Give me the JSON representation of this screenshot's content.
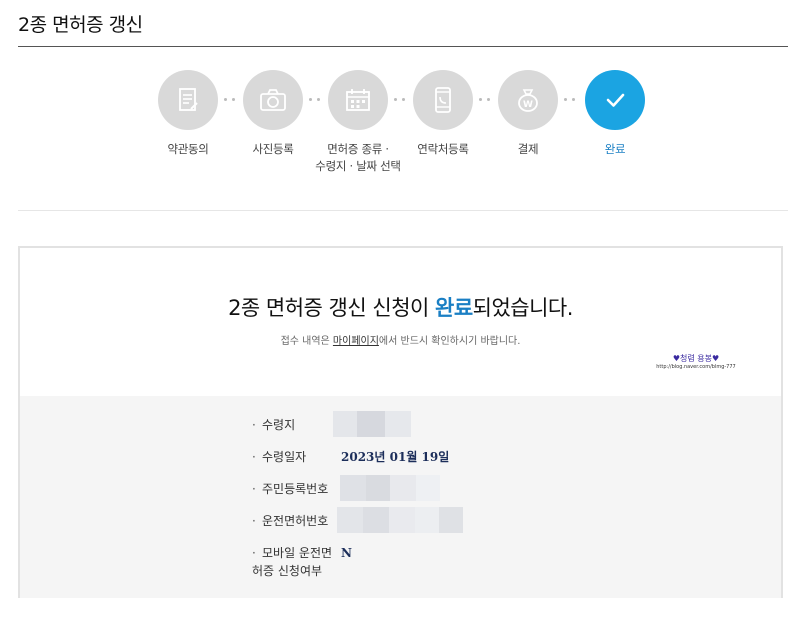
{
  "page": {
    "title": "2종 면허증 갱신"
  },
  "steps": [
    {
      "label": "약관동의",
      "icon": "document-icon",
      "state": "done"
    },
    {
      "label": "사진등록",
      "icon": "camera-icon",
      "state": "done"
    },
    {
      "label": "면허증 종류 ·\n수령지 · 날짜 선택",
      "icon": "calendar-icon",
      "state": "done"
    },
    {
      "label": "연락처등록",
      "icon": "phone-icon",
      "state": "done"
    },
    {
      "label": "결제",
      "icon": "money-bag-icon",
      "state": "done"
    },
    {
      "label": "완료",
      "icon": "check-icon",
      "state": "active"
    }
  ],
  "colors": {
    "active": "#1ba4e2",
    "inactive": "#d9d9d9",
    "highlight": "#1a7fc4"
  },
  "result": {
    "heading_pre": "2종 면허증 갱신 신청이 ",
    "heading_highlight": "완료",
    "heading_post": "되었습니다.",
    "sub_pre": "접수 내역은 ",
    "sub_link": "마이페이지",
    "sub_post": "에서 반드시 확인하시기 바랍니다.",
    "watermark_line1": "♥청렴 용봉♥",
    "watermark_line2": "http://blog.naver.com/blmg-777"
  },
  "info": {
    "bullet": "·",
    "pickup_location_label": "수령지",
    "pickup_date_label": "수령일자",
    "pickup_date_value": "2023년 01월 19일",
    "resident_number_label": "주민등록번호",
    "license_number_label": "운전면허번호",
    "mobile_license_label_line1": "모바일 운전면",
    "mobile_license_label_line2": "허증 신청여부",
    "mobile_license_value": "N"
  }
}
